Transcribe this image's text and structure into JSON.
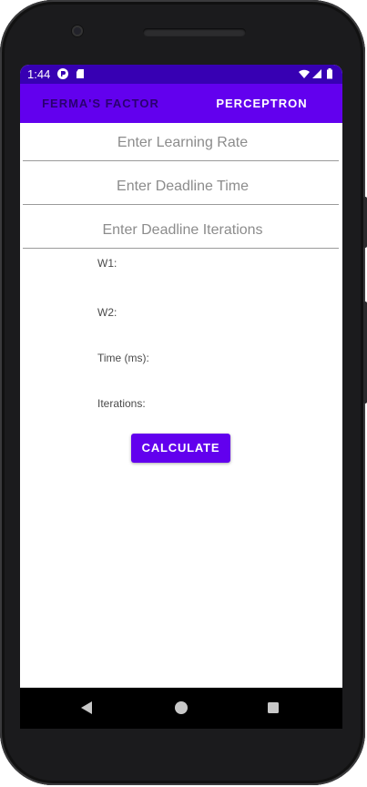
{
  "status_bar": {
    "time": "1:44"
  },
  "tabs": [
    {
      "label": "FERMA'S FACTOR",
      "active": false
    },
    {
      "label": "PERCEPTRON",
      "active": true
    }
  ],
  "form": {
    "learning_rate": {
      "placeholder": "Enter Learning Rate",
      "value": ""
    },
    "deadline_time": {
      "placeholder": "Enter Deadline Time",
      "value": ""
    },
    "deadline_iterations": {
      "placeholder": "Enter Deadline Iterations",
      "value": ""
    }
  },
  "results": {
    "w1_label": "W1:",
    "w2_label": "W2:",
    "time_label": "Time (ms):",
    "iterations_label": "Iterations:"
  },
  "actions": {
    "calculate_label": "CALCULATE"
  },
  "colors": {
    "primary": "#6200ee",
    "primary_dark": "#3700b3",
    "inactive_tab": "#2a0070"
  },
  "icons": {
    "status": [
      "photo-app-icon",
      "sd-card-icon",
      "wifi-icon",
      "cell-signal-icon",
      "battery-icon"
    ],
    "navigation": [
      "back-icon",
      "home-icon",
      "recents-icon"
    ]
  }
}
